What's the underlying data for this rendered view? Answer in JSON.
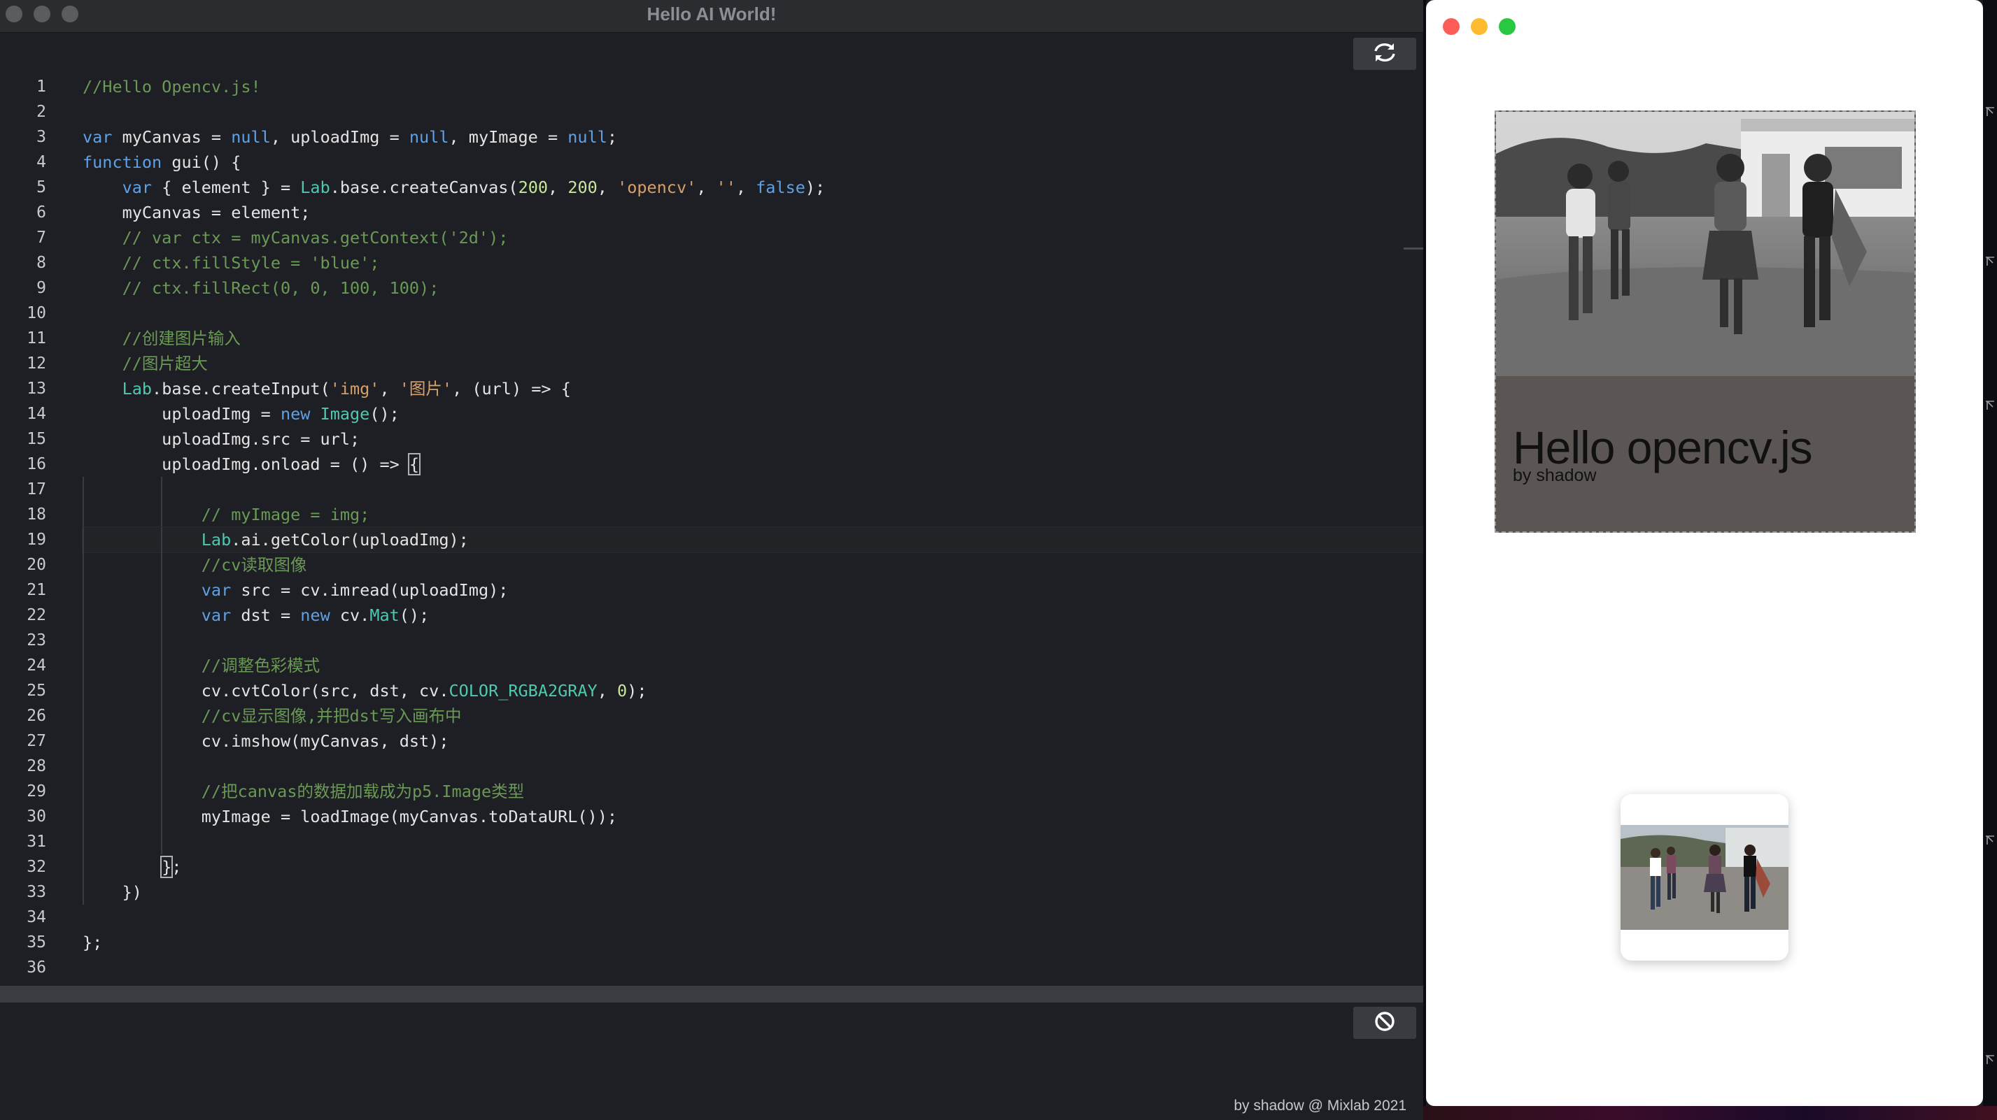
{
  "editor": {
    "title": "Hello AI World!",
    "refresh_icon": "refresh-icon",
    "stop_icon": "block-icon",
    "footer": "by shadow @ Mixlab 2021",
    "line_numbers": [
      "1",
      "2",
      "3",
      "4",
      "5",
      "6",
      "7",
      "8",
      "9",
      "10",
      "11",
      "12",
      "13",
      "14",
      "15",
      "16",
      "17",
      "18",
      "19",
      "20",
      "21",
      "22",
      "23",
      "24",
      "25",
      "26",
      "27",
      "28",
      "29",
      "30",
      "31",
      "32",
      "33",
      "34",
      "35",
      "36"
    ],
    "lines": [
      [
        [
          "c",
          "//Hello Opencv.js!"
        ]
      ],
      [],
      [
        [
          "k",
          "var"
        ],
        [
          "p",
          " myCanvas = "
        ],
        [
          "k",
          "null"
        ],
        [
          "p",
          ", uploadImg = "
        ],
        [
          "k",
          "null"
        ],
        [
          "p",
          ", myImage = "
        ],
        [
          "k",
          "null"
        ],
        [
          "p",
          ";"
        ]
      ],
      [
        [
          "k",
          "function"
        ],
        [
          "p",
          " gui() {"
        ]
      ],
      [
        [
          "p",
          "    "
        ],
        [
          "k",
          "var"
        ],
        [
          "p",
          " { element } = "
        ],
        [
          "t",
          "Lab"
        ],
        [
          "p",
          ".base.createCanvas("
        ],
        [
          "n",
          "200"
        ],
        [
          "p",
          ", "
        ],
        [
          "n",
          "200"
        ],
        [
          "p",
          ", "
        ],
        [
          "s",
          "'opencv'"
        ],
        [
          "p",
          ", "
        ],
        [
          "s",
          "''"
        ],
        [
          "p",
          ", "
        ],
        [
          "k",
          "false"
        ],
        [
          "p",
          ");"
        ]
      ],
      [
        [
          "p",
          "    myCanvas = element;"
        ]
      ],
      [
        [
          "p",
          "    "
        ],
        [
          "c",
          "// var ctx = myCanvas.getContext('2d');"
        ]
      ],
      [
        [
          "p",
          "    "
        ],
        [
          "c",
          "// ctx.fillStyle = 'blue';"
        ]
      ],
      [
        [
          "p",
          "    "
        ],
        [
          "c",
          "// ctx.fillRect(0, 0, 100, 100);"
        ]
      ],
      [],
      [
        [
          "p",
          "    "
        ],
        [
          "c",
          "//创建图片输入"
        ]
      ],
      [
        [
          "p",
          "    "
        ],
        [
          "c",
          "//图片超大"
        ]
      ],
      [
        [
          "p",
          "    "
        ],
        [
          "t",
          "Lab"
        ],
        [
          "p",
          ".base.createInput("
        ],
        [
          "s",
          "'img'"
        ],
        [
          "p",
          ", "
        ],
        [
          "s",
          "'图片'"
        ],
        [
          "p",
          ", (url) => {"
        ]
      ],
      [
        [
          "p",
          "        uploadImg = "
        ],
        [
          "k",
          "new"
        ],
        [
          "p",
          " "
        ],
        [
          "t",
          "Image"
        ],
        [
          "p",
          "();"
        ]
      ],
      [
        [
          "p",
          "        uploadImg.src = url;"
        ]
      ],
      [
        [
          "p",
          "        uploadImg.onload = () => "
        ],
        [
          "bm",
          "{"
        ]
      ],
      [],
      [
        [
          "p",
          "            "
        ],
        [
          "c",
          "// myImage = img;"
        ]
      ],
      [
        [
          "p",
          "            "
        ],
        [
          "t",
          "Lab"
        ],
        [
          "p",
          ".ai.getColor(uploadImg);"
        ]
      ],
      [
        [
          "p",
          "            "
        ],
        [
          "c",
          "//cv读取图像"
        ]
      ],
      [
        [
          "p",
          "            "
        ],
        [
          "k",
          "var"
        ],
        [
          "p",
          " src = cv.imread(uploadImg);"
        ]
      ],
      [
        [
          "p",
          "            "
        ],
        [
          "k",
          "var"
        ],
        [
          "p",
          " dst = "
        ],
        [
          "k",
          "new"
        ],
        [
          "p",
          " cv."
        ],
        [
          "t",
          "Mat"
        ],
        [
          "p",
          "();"
        ]
      ],
      [],
      [
        [
          "p",
          "            "
        ],
        [
          "c",
          "//调整色彩模式"
        ]
      ],
      [
        [
          "p",
          "            cv.cvtColor(src, dst, cv."
        ],
        [
          "t",
          "COLOR_RGBA2GRAY"
        ],
        [
          "p",
          ", "
        ],
        [
          "n",
          "0"
        ],
        [
          "p",
          ");"
        ]
      ],
      [
        [
          "p",
          "            "
        ],
        [
          "c",
          "//cv显示图像,并把dst写入画布中"
        ]
      ],
      [
        [
          "p",
          "            cv.imshow(myCanvas, dst);"
        ]
      ],
      [],
      [
        [
          "p",
          "            "
        ],
        [
          "c",
          "//把canvas的数据加载成为p5.Image类型"
        ]
      ],
      [
        [
          "p",
          "            myImage = loadImage(myCanvas.toDataURL());"
        ]
      ],
      [],
      [
        [
          "p",
          "        "
        ],
        [
          "bm",
          "}"
        ],
        [
          "p",
          ";"
        ]
      ],
      [
        [
          "p",
          "    })"
        ]
      ],
      [],
      [
        [
          "p",
          "};"
        ]
      ],
      []
    ],
    "active_line": 19
  },
  "preview": {
    "canvas_title": "Hello opencv.js",
    "canvas_byline": "by shadow",
    "canvas_photo": "grayscale-photo-four-women-walking",
    "thumbnail_photo": "color-photo-four-women-walking"
  }
}
